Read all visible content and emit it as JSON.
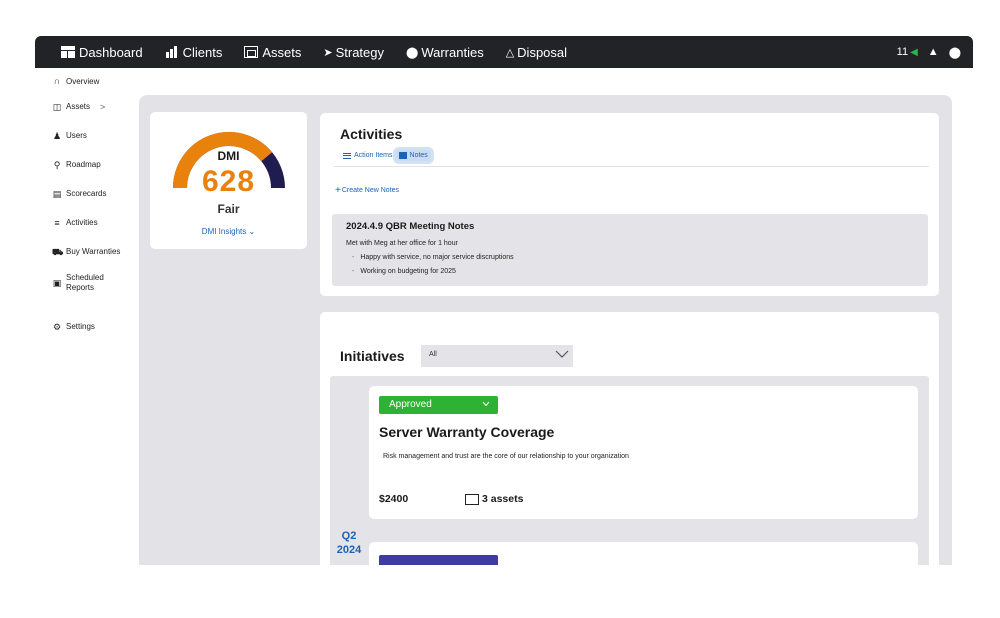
{
  "nav": {
    "items": [
      {
        "label": "Dashboard",
        "icon": "dashboard-icon"
      },
      {
        "label": "Clients",
        "icon": "bar-chart-icon"
      },
      {
        "label": "Assets",
        "icon": "assets-icon"
      },
      {
        "label": "Strategy",
        "icon": "paper-plane-icon"
      },
      {
        "label": "Warranties",
        "icon": "circle-icon"
      },
      {
        "label": "Disposal",
        "icon": "recycle-icon"
      }
    ],
    "notification_count": "11"
  },
  "sidebar": {
    "items": [
      {
        "label": "Overview",
        "icon": "headset-icon"
      },
      {
        "label": "Assets",
        "icon": "assets-icon"
      },
      {
        "label": "Users",
        "icon": "users-icon"
      },
      {
        "label": "Roadmap",
        "icon": "map-pin-icon"
      },
      {
        "label": "Scorecards",
        "icon": "scorecard-icon"
      },
      {
        "label": "Activities",
        "icon": "list-icon"
      },
      {
        "label": "Buy Warranties",
        "icon": "cart-icon"
      },
      {
        "label": "Scheduled Reports",
        "icon": "report-icon"
      },
      {
        "label": "Settings",
        "icon": "gear-icon"
      }
    ]
  },
  "dmi": {
    "label": "DMI",
    "score": "628",
    "grade": "Fair",
    "insights_link": "DMI Insights",
    "gauge_fill": 0.78,
    "colors": {
      "orange": "#e8820c",
      "navy": "#1f1d4f"
    }
  },
  "activities": {
    "title": "Activities",
    "tabs": [
      {
        "label": "Action Items",
        "active": false
      },
      {
        "label": "Notes",
        "active": true
      }
    ],
    "create_label": "Create New Notes",
    "note": {
      "title": "2024.4.9 QBR Meeting Notes",
      "line": "Met with Meg at her office for 1 hour",
      "bullets": [
        "Happy with service, no major service discruptions",
        "Working on budgeting for 2025"
      ]
    }
  },
  "initiatives": {
    "title": "Initiatives",
    "filter_value": "All",
    "quarter": "Q2 2024",
    "items": [
      {
        "status": "Approved",
        "name": "Server Warranty Coverage",
        "description": "Risk management and trust are the core of our relationship to your organization",
        "cost": "$2400",
        "assets": "3 assets"
      }
    ],
    "colors": {
      "approved": "#2db233",
      "second_status": "#3e3ba3"
    }
  }
}
